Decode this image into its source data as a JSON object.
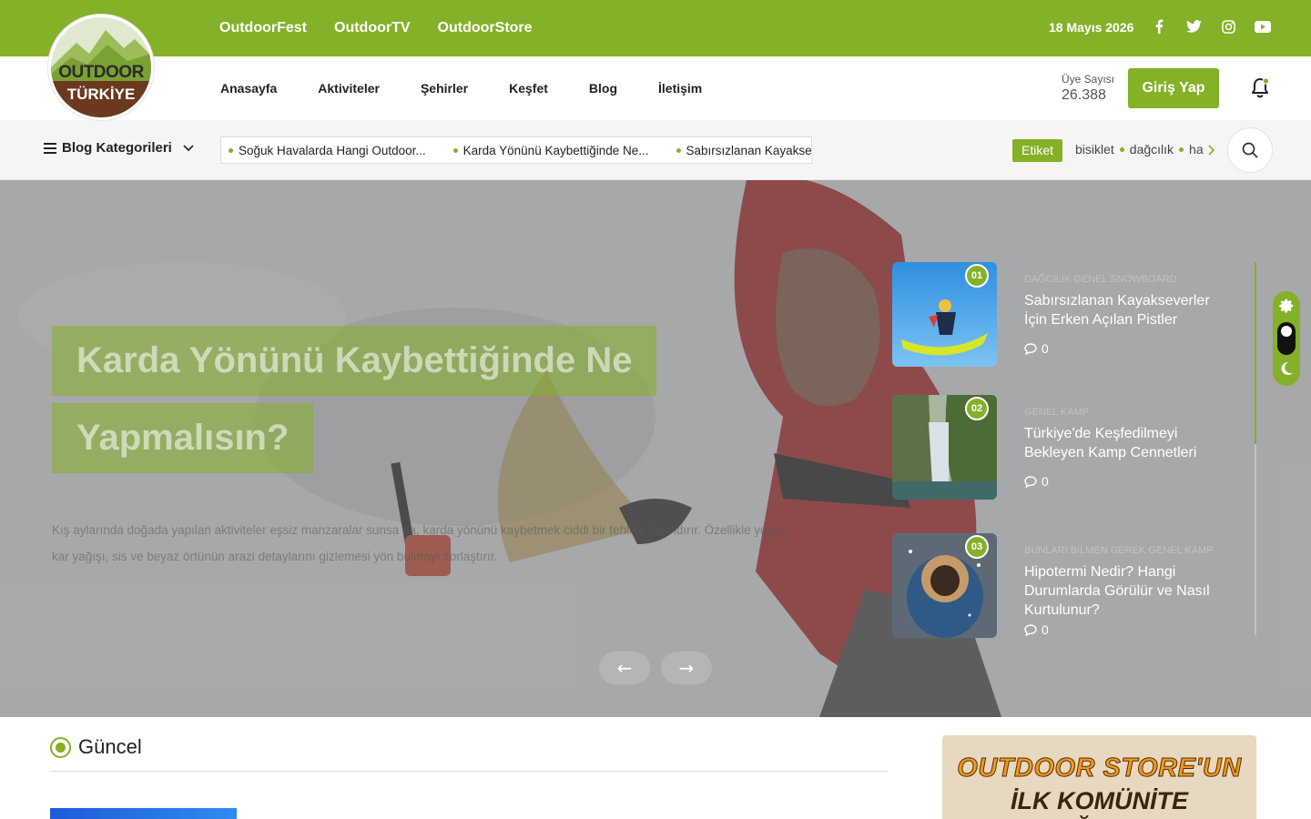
{
  "brand": {
    "line1": "OUTDOOR",
    "line2": "TÜRKİYE"
  },
  "topbar": {
    "links": [
      "OutdoorFest",
      "OutdoorTV",
      "OutdoorStore"
    ],
    "date": "18 Mayıs 2026",
    "social_icons": [
      "facebook-icon",
      "twitter-icon",
      "instagram-icon",
      "youtube-icon"
    ]
  },
  "nav": {
    "items": [
      "Anasayfa",
      "Aktiviteler",
      "Şehirler",
      "Keşfet",
      "Blog",
      "İletişim"
    ],
    "members_label": "Üye Sayısı",
    "members_count": "26.388",
    "login_label": "Giriş Yap"
  },
  "subbar": {
    "categories_label": "Blog Kategorileri",
    "ticker": [
      "Soğuk Havalarda Hangi Outdoor...",
      "Karda Yönünü Kaybettiğinde Ne...",
      "Sabırsızlanan Kayakse"
    ],
    "tag_label": "Etiket",
    "tags": [
      "bisiklet",
      "dağcılık",
      "ha"
    ]
  },
  "hero": {
    "title_line1": "Karda Yönünü Kaybettiğinde Ne",
    "title_line2": "Yapmalısın?",
    "excerpt_line1": "Kış aylarında doğada yapılan aktiviteler eşsiz manzaralar sunsa da, karda yönünü kaybetmek ciddi bir tehlike barındırır. Özellikle yoğun",
    "excerpt_line2": "kar yağışı, sis ve beyaz örtünün arazi detaylarını gizlemesi yön bulmayı zorlaştırır.",
    "prev_label": "←",
    "next_label": "→"
  },
  "side_posts": [
    {
      "num": "01",
      "cats": "DAĞCILIK GENEL SNOWBOARD",
      "title": "Sabırsızlanan Kayakseverler İçin Erken Açılan Pistler",
      "comments": "0"
    },
    {
      "num": "02",
      "cats": "GENEL KAMP",
      "title": "Türkiye'de Keşfedilmeyi Bekleyen Kamp Cennetleri",
      "comments": "0"
    },
    {
      "num": "03",
      "cats": "BUNLARI BİLMEN GEREK GENEL KAMP",
      "title": "Hipotermi Nedir? Hangi Durumlarda Görülür ve Nasıl Kurtulunur?",
      "comments": "0"
    }
  ],
  "section": {
    "title": "Güncel"
  },
  "ad": {
    "line1": "OUTDOOR STORE'UN",
    "line2": "İLK KOMÜNİTE MAĞAZASI"
  },
  "colors": {
    "accent": "#84b128",
    "brown": "#6b3a1e"
  }
}
